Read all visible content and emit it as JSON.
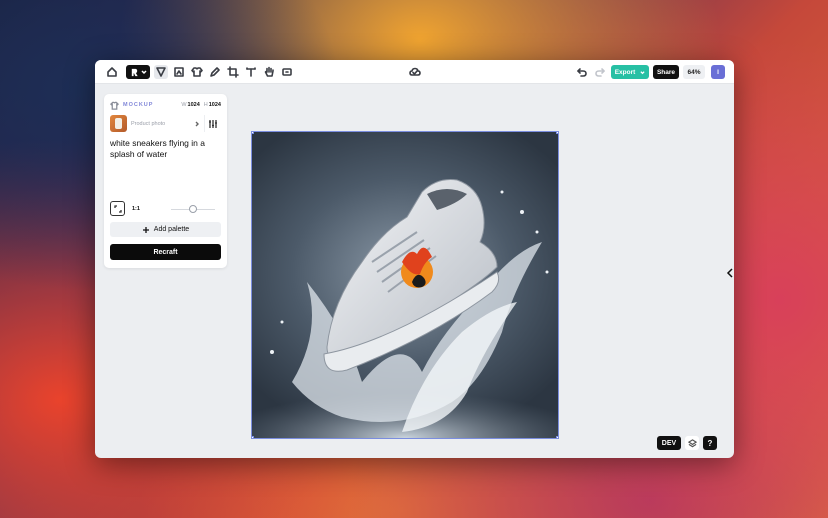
{
  "toolbar": {
    "export_label": "Export",
    "share_label": "Share",
    "zoom_label": "64%",
    "user_initial": "I",
    "tools": [
      "home-icon",
      "brand-icon",
      "select-icon",
      "frame-icon",
      "mockup-icon",
      "pen-icon",
      "crop-icon",
      "text-icon",
      "hand-icon",
      "vector-icon",
      "cloud-icon",
      "undo-icon",
      "redo-icon"
    ]
  },
  "panel": {
    "mode_label": "MOCKUP",
    "width_key": "W",
    "width_value": "1024",
    "height_key": "H",
    "height_value": "1024",
    "style_name": "Product photo",
    "prompt": "white sneakers flying in a splash of water",
    "ratio_label": "1:1",
    "add_palette_label": "Add palette",
    "recraft_label": "Recraft"
  },
  "bottom": {
    "dev_label": "DEV",
    "help_label": "?"
  },
  "colors": {
    "accent_export": "#27c0a4",
    "mode_label": "#8187d8",
    "avatar": "#6a6fd6",
    "selection": "#7b8ee0"
  }
}
